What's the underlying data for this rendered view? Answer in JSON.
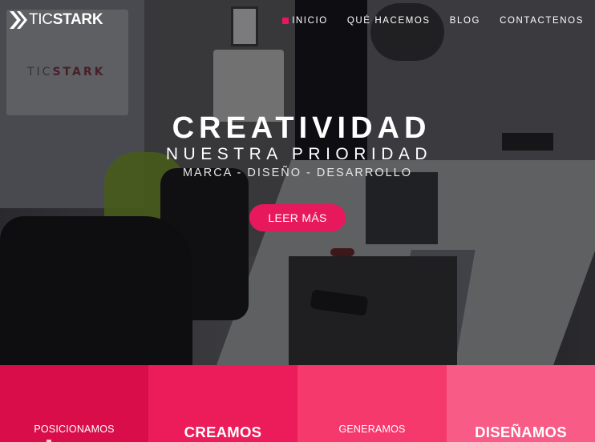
{
  "brand": {
    "name_light": "TIC",
    "name_bold": "STARK",
    "icon": "double-chevron-logo-icon"
  },
  "nav": {
    "items": [
      {
        "label": "INICIO",
        "active": true
      },
      {
        "label": "QUÉ HACEMOS",
        "active": false
      },
      {
        "label": "BLOG",
        "active": false
      },
      {
        "label": "CONTACTENOS",
        "active": false
      }
    ]
  },
  "hero": {
    "title": "CREATIVIDAD",
    "subtitle": "NUESTRA PRIORIDAD",
    "tagline": "MARCA - DISEÑO - DESARROLLO",
    "cta_label": "LEER MÁS",
    "background_poster_text_light": "TIC",
    "background_poster_text_bold": "STARK"
  },
  "tiles": [
    {
      "label": "POSICIONAMOS",
      "style": "small",
      "color": "#d90d4a"
    },
    {
      "label": "CREAMOS",
      "style": "large",
      "color": "#ec1c5a"
    },
    {
      "label": "GENERAMOS",
      "style": "small",
      "color": "#f6396c"
    },
    {
      "label": "DISEÑAMOS",
      "style": "large",
      "color": "#f75b86"
    }
  ],
  "colors": {
    "accent": "#e8175d",
    "text": "#ffffff"
  }
}
